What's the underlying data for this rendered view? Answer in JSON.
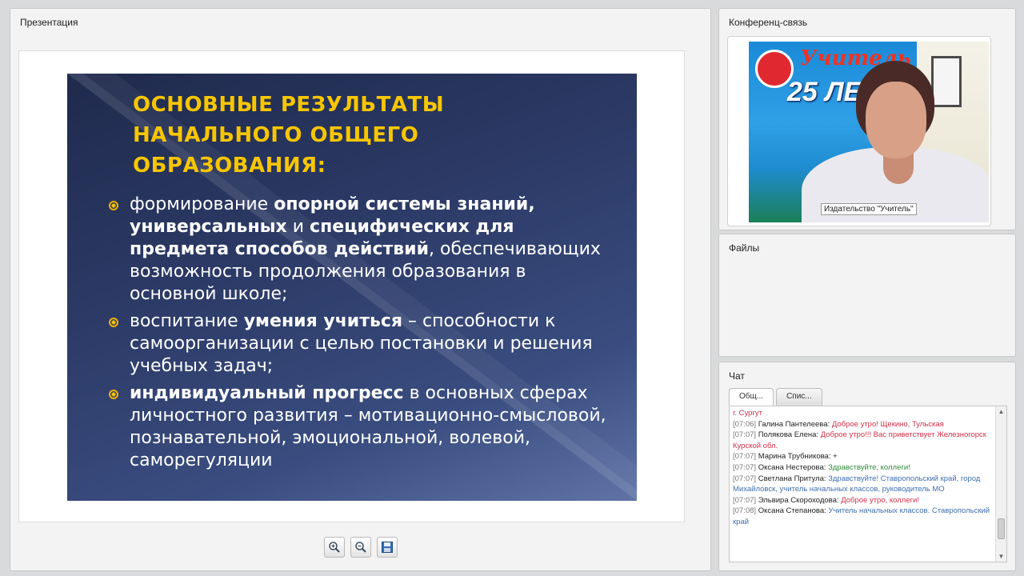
{
  "presentation": {
    "title": "Презентация",
    "slide": {
      "heading": "ОСНОВНЫЕ РЕЗУЛЬТАТЫ НАЧАЛЬНОГО ОБЩЕГО ОБРАЗОВАНИЯ:",
      "bullets": [
        {
          "parts": [
            {
              "t": "формирование ",
              "b": false
            },
            {
              "t": "опорной системы знаний, универсальных",
              "b": true
            },
            {
              "t": " и ",
              "b": false
            },
            {
              "t": "специфических для предмета способов действий",
              "b": true
            },
            {
              "t": ", обеспечивающих возможность продолжения образования в основной школе;",
              "b": false
            }
          ]
        },
        {
          "parts": [
            {
              "t": "воспитание ",
              "b": false
            },
            {
              "t": "умения учиться",
              "b": true
            },
            {
              "t": " – способности к самоорганизации с целью постановки и решения учебных задач;",
              "b": false
            }
          ]
        },
        {
          "parts": [
            {
              "t": "индивидуальный прогресс",
              "b": true
            },
            {
              "t": " в основных сферах личностного развития – мотивационно-смысловой, познавательной, эмоциональной, волевой, саморегуляции",
              "b": false
            }
          ]
        }
      ]
    },
    "toolbar": {
      "zoom_in": "zoom-in-icon",
      "zoom_out": "zoom-out-icon",
      "save": "save-icon"
    }
  },
  "conference": {
    "title": "Конференц-связь",
    "video": {
      "banner_word": "Учитель",
      "banner_number": "25 ЛЕТ",
      "caption": "Издательство \"Учитель\""
    }
  },
  "files": {
    "title": "Файлы"
  },
  "chat": {
    "title": "Чат",
    "tabs": [
      "Общ...",
      "Спис..."
    ],
    "messages": [
      {
        "time": "",
        "name": "",
        "text": "г. Сургут",
        "color": "#d0304a"
      },
      {
        "time": "[07:06]",
        "name": "Галина Пантелеева:",
        "text": "Доброе утро! Щекино, Тульская",
        "color": "#d0304a"
      },
      {
        "time": "[07:07]",
        "name": "Полякова Елена:",
        "text": "Доброе утро!!! Вас приветствует Железногорск Курской обл.",
        "color": "#d0304a"
      },
      {
        "time": "[07:07]",
        "name": "Марина Трубникова:",
        "text": "+",
        "color": "#222222"
      },
      {
        "time": "[07:07]",
        "name": "Оксана Нестерова:",
        "text": "Здравствуйте, коллеги!",
        "color": "#2e8a3a"
      },
      {
        "time": "[07:07]",
        "name": "Светлана Притула:",
        "text": "Здравствуйте! Ставропольский край, город Михайловск, учитель начальных классов, руководитель МО",
        "color": "#3f6fb0"
      },
      {
        "time": "[07:07]",
        "name": "Эльвира Скороходова:",
        "text": "Доброе утро, коллеги!",
        "color": "#d0304a"
      },
      {
        "time": "[07:08]",
        "name": "Оксана Степанова:",
        "text": "Учитель начальных классов. Ставропольский край",
        "color": "#3f6fb0"
      }
    ]
  }
}
